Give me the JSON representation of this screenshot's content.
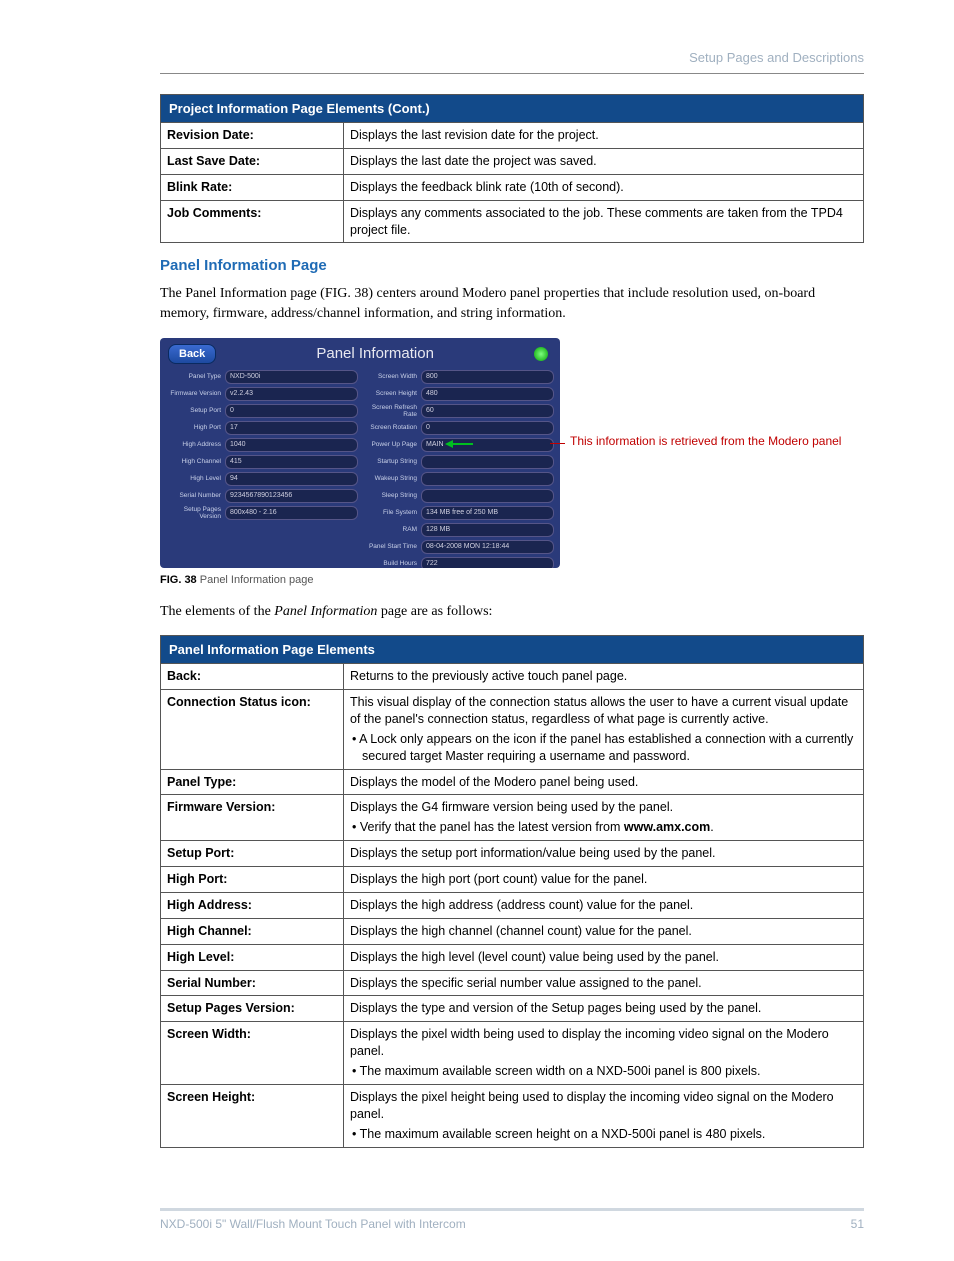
{
  "header": {
    "right": "Setup Pages and Descriptions"
  },
  "table1": {
    "title": "Project Information Page Elements (Cont.)",
    "rows": [
      {
        "label": "Revision Date:",
        "desc": "Displays the last revision date for the project."
      },
      {
        "label": "Last Save Date:",
        "desc": "Displays the last date the project was saved."
      },
      {
        "label": "Blink Rate:",
        "desc": "Displays the feedback blink rate (10th of second)."
      },
      {
        "label": "Job Comments:",
        "desc": "Displays any comments associated to the job. These comments are taken from the TPD4 project file."
      }
    ]
  },
  "section": {
    "heading": "Panel Information Page",
    "p1": "The Panel Information page (FIG. 38) centers around Modero panel properties that include resolution used, on-board memory, firmware, address/channel information, and string information."
  },
  "figure": {
    "back": "Back",
    "title": "Panel Information",
    "left": [
      {
        "l": "Panel Type",
        "v": "NXD-500i"
      },
      {
        "l": "Firmware Version",
        "v": "v2.2.43"
      },
      {
        "l": "Setup Port",
        "v": "0"
      },
      {
        "l": "High Port",
        "v": "17"
      },
      {
        "l": "High Address",
        "v": "1040"
      },
      {
        "l": "High Channel",
        "v": "415"
      },
      {
        "l": "High Level",
        "v": "94"
      },
      {
        "l": "Serial Number",
        "v": "9234567890123456"
      },
      {
        "l": "Setup Pages Version",
        "v": "800x480 - 2.16"
      }
    ],
    "right": [
      {
        "l": "Screen Width",
        "v": "800"
      },
      {
        "l": "Screen Height",
        "v": "480"
      },
      {
        "l": "Screen Refresh Rate",
        "v": "60"
      },
      {
        "l": "Screen Rotation",
        "v": "0"
      },
      {
        "l": "Power Up Page",
        "v": "MAIN",
        "highlight": true
      },
      {
        "l": "Startup String",
        "v": ""
      },
      {
        "l": "Wakeup String",
        "v": ""
      },
      {
        "l": "Sleep String",
        "v": ""
      },
      {
        "l": "File System",
        "v": "134 MB free of 250 MB"
      },
      {
        "l": "RAM",
        "v": "128 MB"
      },
      {
        "l": "Panel Start Time",
        "v": "08-04-2008 MON 12:18:44"
      },
      {
        "l": "Build Hours",
        "v": "722"
      }
    ],
    "callout": "This information is retrieved from the Modero panel",
    "caption_b": "FIG. 38",
    "caption": "  Panel Information page"
  },
  "p2_pre": "The elements of the ",
  "p2_em": "Panel Information",
  "p2_post": " page are as follows:",
  "table2": {
    "title": "Panel Information Page Elements",
    "rows": [
      {
        "label": "Back:",
        "desc": "Returns to the previously active touch panel page."
      },
      {
        "label": "Connection Status icon:",
        "desc": "This visual display of the connection status allows the user to have a current visual update of the panel's connection status, regardless of what page is currently active.",
        "bullets": [
          "A Lock only appears on the icon if the panel has established a connection with a currently secured target Master requiring a username and password."
        ]
      },
      {
        "label": "Panel Type:",
        "desc": "Displays the model of the Modero panel being used."
      },
      {
        "label": "Firmware Version:",
        "desc": "Displays the G4 firmware version being used by the panel.",
        "bullets_html": "• Verify that the panel has the latest version from <b>www.amx.com</b>."
      },
      {
        "label": "Setup Port:",
        "desc": "Displays the setup port information/value being used by the panel."
      },
      {
        "label": "High Port:",
        "desc": "Displays the high port (port count) value for the panel."
      },
      {
        "label": "High Address:",
        "desc": "Displays the high address (address count) value for the panel."
      },
      {
        "label": "High Channel:",
        "desc": "Displays the high channel (channel count) value for the panel."
      },
      {
        "label": "High Level:",
        "desc": "Displays the high level (level count) value being used by the panel."
      },
      {
        "label": "Serial Number:",
        "desc": "Displays the specific serial number value assigned to the panel."
      },
      {
        "label": "Setup Pages Version:",
        "desc": "Displays the type and version of the Setup pages being used by the panel."
      },
      {
        "label": "Screen Width:",
        "desc": "Displays the pixel width being used to display the incoming video signal on the Modero panel.",
        "bullets": [
          "The maximum available screen width on a NXD-500i panel is 800 pixels."
        ]
      },
      {
        "label": "Screen Height:",
        "desc": "Displays the pixel height being used to display the incoming video signal on the Modero panel.",
        "bullets": [
          "The maximum available screen height on a NXD-500i panel is 480 pixels."
        ]
      }
    ]
  },
  "footer": {
    "left": "NXD-500i 5\" Wall/Flush Mount Touch Panel with Intercom",
    "right": "51"
  }
}
